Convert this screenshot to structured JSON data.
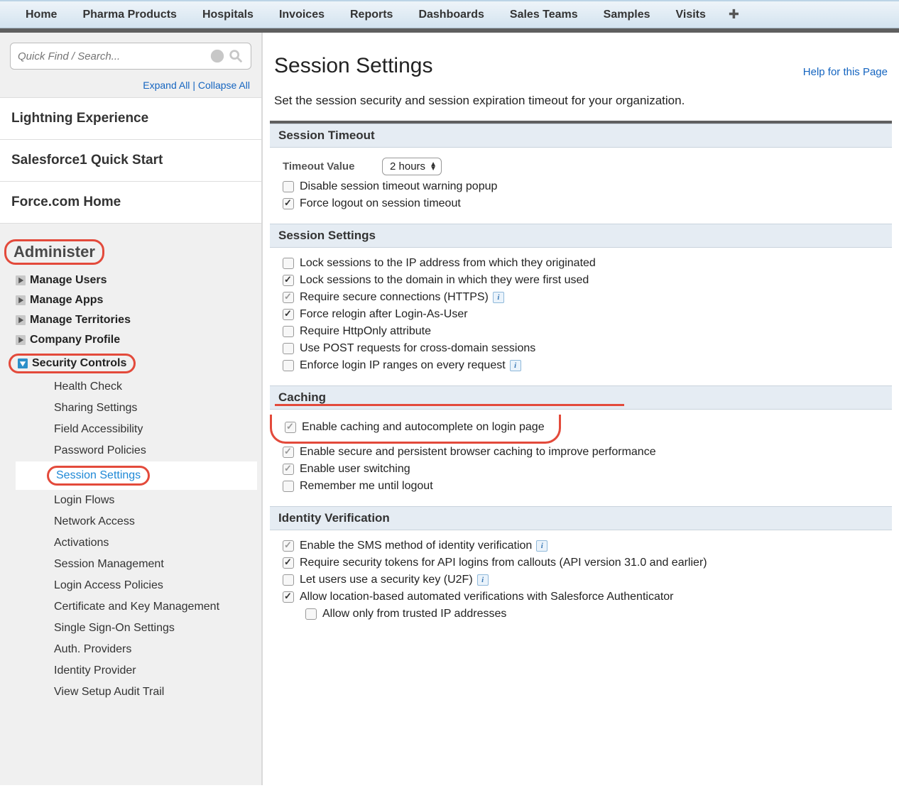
{
  "topnav": {
    "tabs": [
      "Home",
      "Pharma Products",
      "Hospitals",
      "Invoices",
      "Reports",
      "Dashboards",
      "Sales Teams",
      "Samples",
      "Visits"
    ]
  },
  "sidebar": {
    "search_placeholder": "Quick Find / Search...",
    "expand": "Expand All",
    "collapse": "Collapse All",
    "sections": {
      "lightning": "Lightning Experience",
      "sf1": "Salesforce1 Quick Start",
      "force": "Force.com Home"
    },
    "admin": {
      "header": "Administer",
      "nodes": {
        "manage_users": "Manage Users",
        "manage_apps": "Manage Apps",
        "manage_territories": "Manage Territories",
        "company_profile": "Company Profile",
        "security_controls": "Security Controls"
      },
      "security_children": {
        "health_check": "Health Check",
        "sharing_settings": "Sharing Settings",
        "field_accessibility": "Field Accessibility",
        "password_policies": "Password Policies",
        "session_settings": "Session Settings",
        "login_flows": "Login Flows",
        "network_access": "Network Access",
        "activations": "Activations",
        "session_management": "Session Management",
        "login_access_policies": "Login Access Policies",
        "cert_key": "Certificate and Key Management",
        "sso": "Single Sign-On Settings",
        "auth_providers": "Auth. Providers",
        "identity_provider": "Identity Provider",
        "audit_trail": "View Setup Audit Trail"
      }
    }
  },
  "main": {
    "title": "Session Settings",
    "help": "Help for this Page",
    "desc": "Set the session security and session expiration timeout for your organization.",
    "timeout": {
      "header": "Session Timeout",
      "timeout_label": "Timeout Value",
      "timeout_value": "2 hours",
      "disable_popup": "Disable session timeout warning popup",
      "force_logout": "Force logout on session timeout"
    },
    "session": {
      "header": "Session Settings",
      "lock_ip": "Lock sessions to the IP address from which they originated",
      "lock_domain": "Lock sessions to the domain in which they were first used",
      "require_https": "Require secure connections (HTTPS)",
      "force_relogin": "Force relogin after Login-As-User",
      "http_only": "Require HttpOnly attribute",
      "use_post": "Use POST requests for cross-domain sessions",
      "enforce_ip": "Enforce login IP ranges on every request"
    },
    "caching": {
      "header": "Caching",
      "enable_caching": "Enable caching and autocomplete on login page",
      "enable_secure": "Enable secure and persistent browser caching to improve performance",
      "enable_switch": "Enable user switching",
      "remember_me": "Remember me until logout"
    },
    "identity": {
      "header": "Identity Verification",
      "sms": "Enable the SMS method of identity verification",
      "tokens": "Require security tokens for API logins from callouts (API version 31.0 and earlier)",
      "u2f": "Let users use a security key (U2F)",
      "location": "Allow location-based automated verifications with Salesforce Authenticator",
      "trusted_ip": "Allow only from trusted IP addresses"
    }
  }
}
